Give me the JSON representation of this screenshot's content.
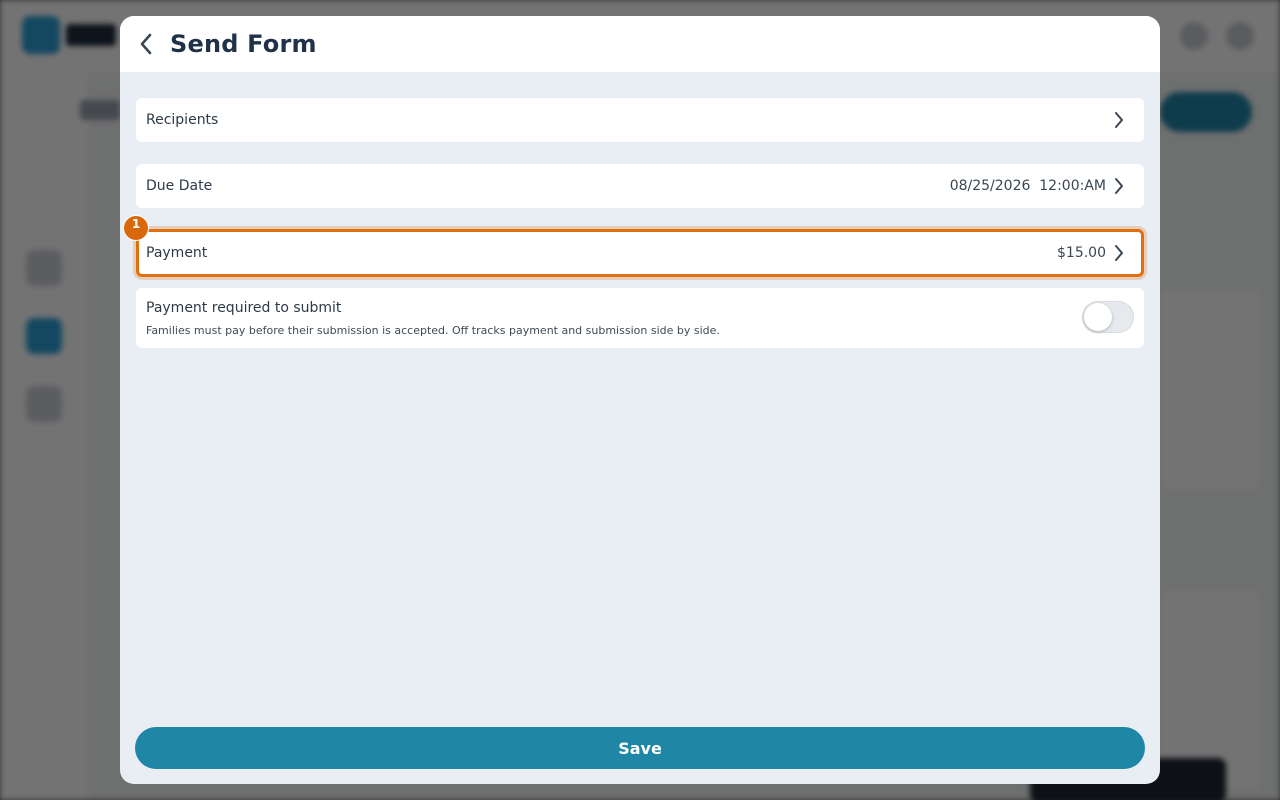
{
  "modal": {
    "title": "Send Form",
    "back_icon": "chevron-left-icon",
    "rows": {
      "recipients": {
        "label": "Recipients",
        "value": ""
      },
      "due_date": {
        "label": "Due Date",
        "value": "08/25/2026  12:00:AM"
      },
      "payment": {
        "label": "Payment",
        "value": "$15.00",
        "badge": "1"
      }
    },
    "payment_required": {
      "title": "Payment required to submit",
      "description": "Families must pay before their submission is accepted. Off tracks payment and submission side by side.",
      "enabled": false
    },
    "save_label": "Save"
  },
  "colors": {
    "accent": "#1f86a6",
    "highlight": "#e0700f",
    "modal_bg": "#e9eef5"
  }
}
